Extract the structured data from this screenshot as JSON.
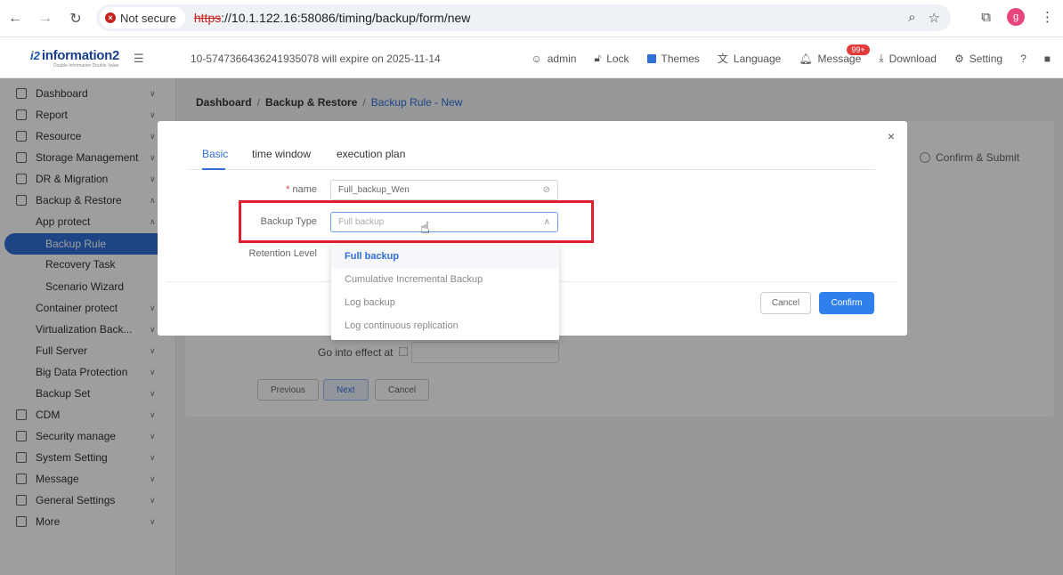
{
  "browser": {
    "security_label": "Not secure",
    "url_scheme": "https",
    "url_rest": "://10.1.122.16:58086/timing/backup/form/new",
    "profile_initial": "g"
  },
  "header": {
    "logo_mark": "i2",
    "logo_text": "information2",
    "logo_sub": "Double Information Double Value",
    "license_notice": "10-5747366436241935078 will expire on 2025-11-14",
    "user": "admin",
    "lock": "Lock",
    "themes": "Themes",
    "language": "Language",
    "message": "Message",
    "message_badge": "99+",
    "download": "Download",
    "setting": "Setting"
  },
  "sidebar": {
    "items": [
      {
        "label": "Dashboard"
      },
      {
        "label": "Report"
      },
      {
        "label": "Resource"
      },
      {
        "label": "Storage Management"
      },
      {
        "label": "DR & Migration"
      },
      {
        "label": "Backup & Restore"
      },
      {
        "label": "App protect"
      },
      {
        "label": "Backup Rule"
      },
      {
        "label": "Recovery Task"
      },
      {
        "label": "Scenario Wizard"
      },
      {
        "label": "Container protect"
      },
      {
        "label": "Virtualization Back..."
      },
      {
        "label": "Full Server"
      },
      {
        "label": "Big Data Protection"
      },
      {
        "label": "Backup Set"
      },
      {
        "label": "CDM"
      },
      {
        "label": "Security manage"
      },
      {
        "label": "System Setting"
      },
      {
        "label": "Message"
      },
      {
        "label": "General Settings"
      },
      {
        "label": "More"
      }
    ]
  },
  "breadcrumb": {
    "root": "Dashboard",
    "section": "Backup & Restore",
    "current": "Backup Rule - New"
  },
  "page": {
    "step_label": "Confirm & Submit",
    "effect_label": "Go into effect at",
    "btn_previous": "Previous",
    "btn_next": "Next",
    "btn_cancel": "Cancel"
  },
  "modal": {
    "tabs": [
      "Basic",
      "time window",
      "execution plan"
    ],
    "name_label": "name",
    "name_value": "Full_backup_Wen",
    "backup_type_label": "Backup Type",
    "backup_type_value": "Full backup",
    "retention_label": "Retention Level",
    "cancel": "Cancel",
    "confirm": "Confirm"
  },
  "dropdown": {
    "options": [
      "Full backup",
      "Cumulative Incremental Backup",
      "Log backup",
      "Log continuous replication"
    ],
    "selected": "Full backup"
  },
  "colors": {
    "accent": "#2f6fd6",
    "highlight_box": "#e01f2e",
    "badge": "#e23b3b"
  }
}
